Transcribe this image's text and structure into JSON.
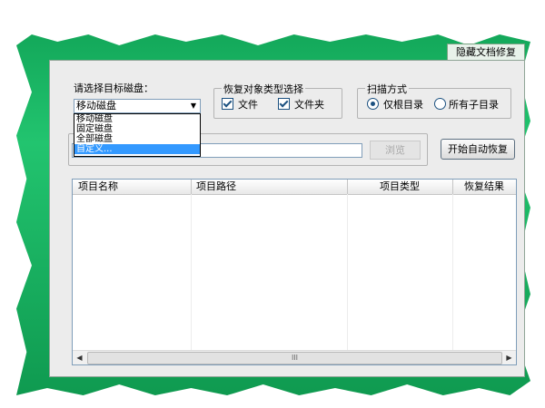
{
  "window_title": "隐藏文档修复",
  "target_disk": {
    "label": "请选择目标磁盘：",
    "selected": "移动磁盘",
    "options": [
      "移动磁盘",
      "固定磁盘",
      "全部磁盘",
      "自定义..."
    ],
    "highlighted_option": "自定义..."
  },
  "object_type_group": {
    "title": "恢复对象类型选择",
    "file_label": "文件",
    "folder_label": "文件夹"
  },
  "scan_mode_group": {
    "title": "扫描方式",
    "root_only_label": "仅根目录",
    "all_subdirs_label": "所有子目录"
  },
  "path": {
    "browse_label": "浏览",
    "start_label": "开始自动恢复"
  },
  "results_table": {
    "columns": [
      "项目名称",
      "项目路径",
      "项目类型",
      "恢复结果"
    ]
  },
  "scrollbar": {
    "thumb_grip": "III"
  }
}
